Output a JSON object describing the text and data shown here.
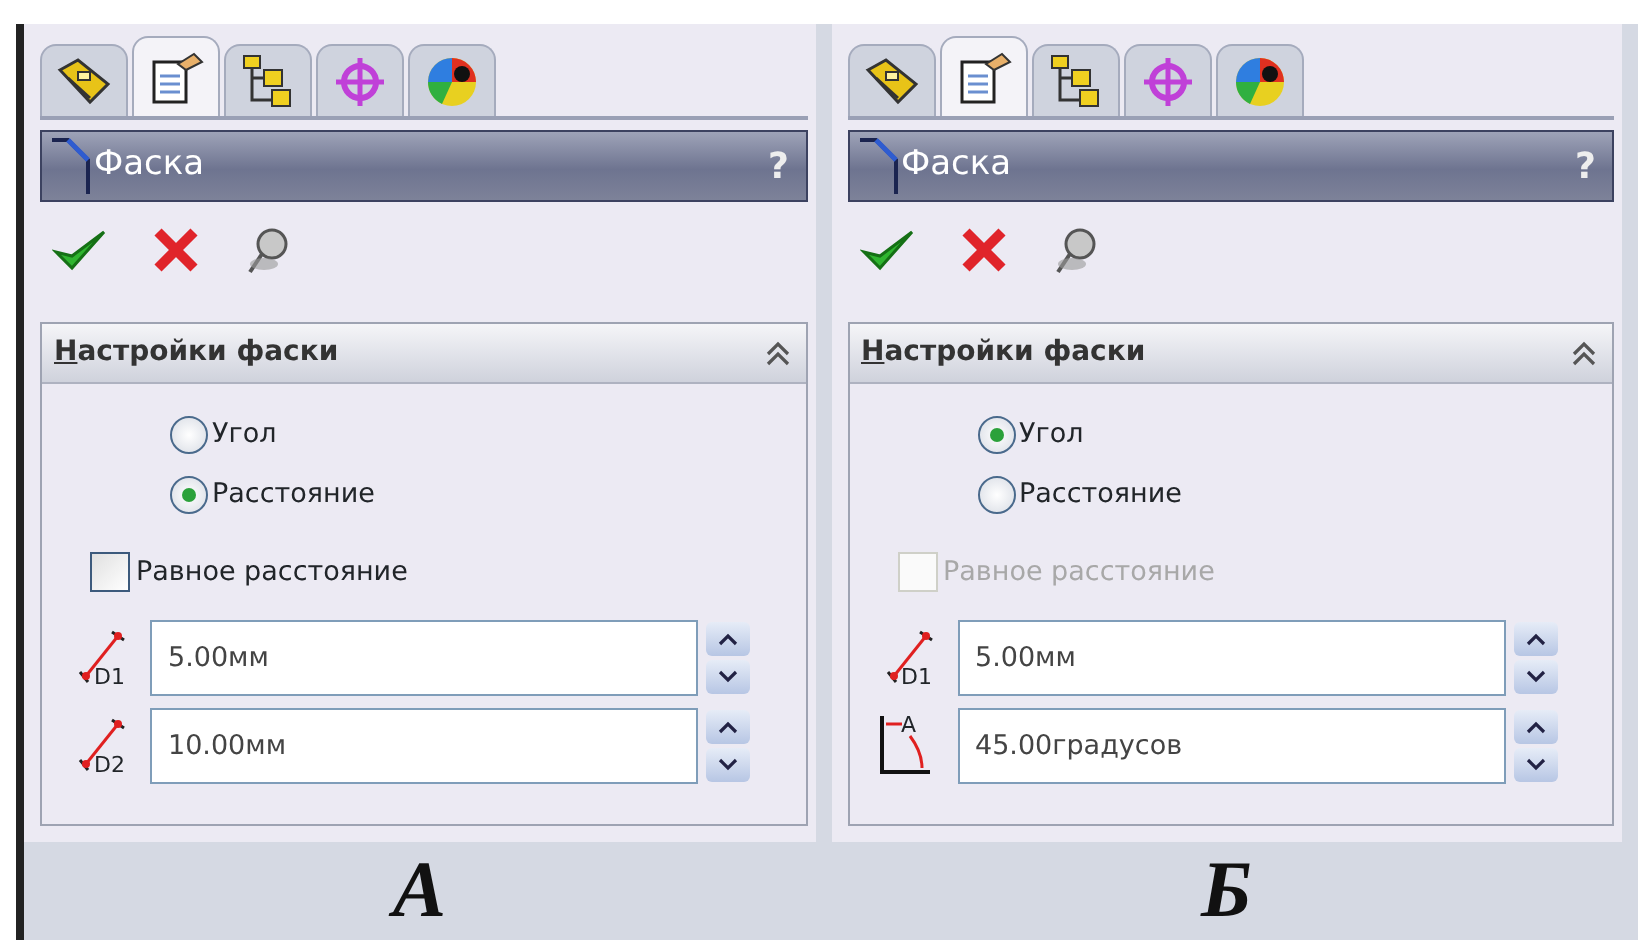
{
  "panels": [
    {
      "tabs": [
        {
          "selected": false
        },
        {
          "selected": true
        },
        {
          "selected": false
        },
        {
          "selected": false
        },
        {
          "selected": false
        }
      ],
      "title": "Фаска",
      "help": "?",
      "group": {
        "title": "Настройки фаски",
        "options": [
          {
            "label": "Угол",
            "selected": false
          },
          {
            "label": "Расстояние",
            "selected": true
          }
        ],
        "checkbox": {
          "label": "Равное расстояние",
          "checked": false,
          "disabled": false
        },
        "fields": [
          {
            "kind": "distance",
            "label": "D1",
            "value": "5.00мм"
          },
          {
            "kind": "distance",
            "label": "D2",
            "value": "10.00мм"
          }
        ]
      },
      "caption": "А"
    },
    {
      "tabs": [
        {
          "selected": false
        },
        {
          "selected": true
        },
        {
          "selected": false
        },
        {
          "selected": false
        },
        {
          "selected": false
        }
      ],
      "title": "Фаска",
      "help": "?",
      "group": {
        "title": "Настройки фаски",
        "options": [
          {
            "label": "Угол",
            "selected": true
          },
          {
            "label": "Расстояние",
            "selected": false
          }
        ],
        "checkbox": {
          "label": "Равное расстояние",
          "checked": false,
          "disabled": true
        },
        "fields": [
          {
            "kind": "distance",
            "label": "D1",
            "value": "5.00мм"
          },
          {
            "kind": "angle",
            "label": "A",
            "value": "45.00градусов"
          }
        ]
      },
      "caption": "Б"
    }
  ]
}
